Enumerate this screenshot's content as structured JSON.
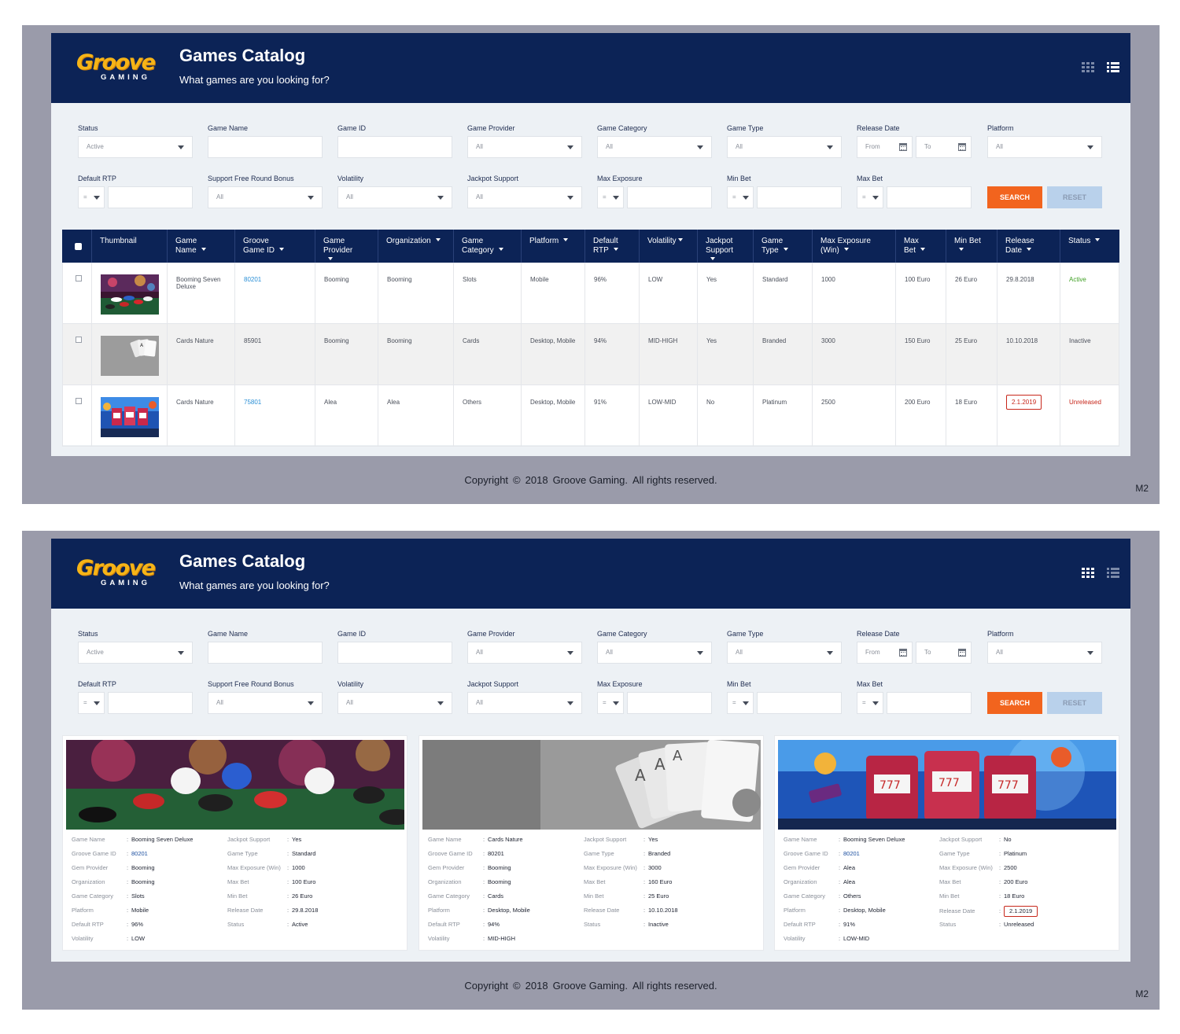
{
  "app": {
    "logo_main": "Groove",
    "logo_sub": "GAMING",
    "title": "Games Catalog",
    "subtitle": "What games are you looking for?"
  },
  "filters": {
    "status": {
      "label": "Status",
      "value": "Active"
    },
    "game_name": {
      "label": "Game Name",
      "value": ""
    },
    "game_id": {
      "label": "Game ID",
      "value": ""
    },
    "game_provider": {
      "label": "Game Provider",
      "value": "All"
    },
    "game_category": {
      "label": "Game Category",
      "value": "All"
    },
    "game_type": {
      "label": "Game Type",
      "value": "All"
    },
    "release_date": {
      "label": "Release Date",
      "from_placeholder": "From",
      "to_placeholder": "To"
    },
    "platform": {
      "label": "Platform",
      "value": "All"
    },
    "default_rtp": {
      "label": "Default RTP",
      "operator": "="
    },
    "free_round": {
      "label": "Support Free Round Bonus",
      "value": "All"
    },
    "volatility": {
      "label": "Volatility",
      "value": "All"
    },
    "jackpot": {
      "label": "Jackpot Support",
      "value": "All"
    },
    "max_exposure": {
      "label": "Max Exposure",
      "operator": "="
    },
    "min_bet": {
      "label": "Min Bet",
      "operator": "="
    },
    "max_bet": {
      "label": "Max Bet",
      "operator": "="
    },
    "search_label": "SEARCH",
    "reset_label": "RESET"
  },
  "table": {
    "headers": {
      "thumbnail": "Thumbnail",
      "game_name": "Game Name",
      "groove_id": "Groove Game ID",
      "provider": "Game Provider",
      "organization": "Organization",
      "category": "Game Category",
      "platform": "Platform",
      "rtp": "Default RTP",
      "volatility": "Volatility",
      "jackpot": "Jackpot Support",
      "type": "Game Type",
      "max_exposure": "Max Exposure (Win)",
      "max_bet": "Max Bet",
      "min_bet": "Min Bet",
      "release": "Release Date",
      "status": "Status"
    },
    "rows": [
      {
        "name": "Booming Seven Deluxe",
        "id": "80201",
        "provider": "Booming",
        "org": "Booming",
        "category": "Slots",
        "platform": "Mobile",
        "rtp": "96%",
        "volatility": "LOW",
        "jackpot": "Yes",
        "type": "Standard",
        "exposure": "1000",
        "max_bet": "100 Euro",
        "min_bet": "26 Euro",
        "release": "29.8.2018",
        "status": "Active"
      },
      {
        "name": "Cards Nature",
        "id": "85901",
        "provider": "Booming",
        "org": "Booming",
        "category": "Cards",
        "platform": "Desktop, Mobile",
        "rtp": "94%",
        "volatility": "MID-HIGH",
        "jackpot": "Yes",
        "type": "Branded",
        "exposure": "3000",
        "max_bet": "150 Euro",
        "min_bet": "25 Euro",
        "release": "10.10.2018",
        "status": "Inactive"
      },
      {
        "name": "Cards Nature",
        "id": "75801",
        "provider": "Alea",
        "org": "Alea",
        "category": "Others",
        "platform": "Desktop, Mobile",
        "rtp": "91%",
        "volatility": "LOW-MID",
        "jackpot": "No",
        "type": "Platinum",
        "exposure": "2500",
        "max_bet": "200 Euro",
        "min_bet": "18 Euro",
        "release": "2.1.2019",
        "status": "Unreleased"
      }
    ]
  },
  "cards": {
    "labels": {
      "game_name": "Game Name",
      "groove_id": "Groove Game ID",
      "provider": "Gem Provider",
      "org": "Organization",
      "category": "Game Category",
      "platform": "Platform",
      "rtp": "Default RTP",
      "volatility": "Volatility",
      "jackpot": "Jackpot Support",
      "type": "Game Type",
      "exposure": "Max Exposure (Win)",
      "max_bet": "Max Bet",
      "min_bet": "Min Bet",
      "release": "Release Date",
      "status": "Status"
    },
    "items": [
      {
        "name": "Booming Seven Deluxe",
        "id": "80201",
        "provider": "Booming",
        "org": "Booming",
        "category": "Slots",
        "platform": "Mobile",
        "rtp": "96%",
        "volatility": "LOW",
        "jackpot": "Yes",
        "type": "Standard",
        "exposure": "1000",
        "max_bet": "100 Euro",
        "min_bet": "26 Euro",
        "release": "29.8.2018",
        "status": "Active"
      },
      {
        "name": "Cards Nature",
        "id": "80201",
        "provider": "Booming",
        "org": "Booming",
        "category": "Cards",
        "platform": "Desktop, Mobile",
        "rtp": "94%",
        "volatility": "MID-HIGH",
        "jackpot": "Yes",
        "type": "Branded",
        "exposure": "3000",
        "max_bet": "160 Euro",
        "min_bet": "25 Euro",
        "release": "10.10.2018",
        "status": "Inactive"
      },
      {
        "name": "Booming Seven Deluxe",
        "id": "80201",
        "provider": "Alea",
        "org": "Alea",
        "category": "Others",
        "platform": "Desktop, Mobile",
        "rtp": "91%",
        "volatility": "LOW-MID",
        "jackpot": "No",
        "type": "Platinum",
        "exposure": "2500",
        "max_bet": "200 Euro",
        "min_bet": "18 Euro",
        "release": "2.1.2019",
        "status": "Unreleased"
      }
    ]
  },
  "footer": {
    "copyright": "Copyright",
    "symbol": "©",
    "year": "2018",
    "company": "Groove Gaming.",
    "rights": "All rights reserved.",
    "mark": "M2"
  },
  "colors": {
    "header_bg": "#0c2356",
    "accent_orange": "#f2641e",
    "reset_bg": "#b9d1eb",
    "link_blue": "#2a8fd6",
    "status_active": "#40a025",
    "status_unreleased": "#c7271b",
    "logo_yellow": "#f6b417",
    "frame_gray": "#9a9baa"
  },
  "icons": [
    "grid-view-icon",
    "list-view-icon",
    "chevron-down-icon",
    "calendar-icon",
    "sort-caret-icon",
    "checkbox-icon"
  ]
}
